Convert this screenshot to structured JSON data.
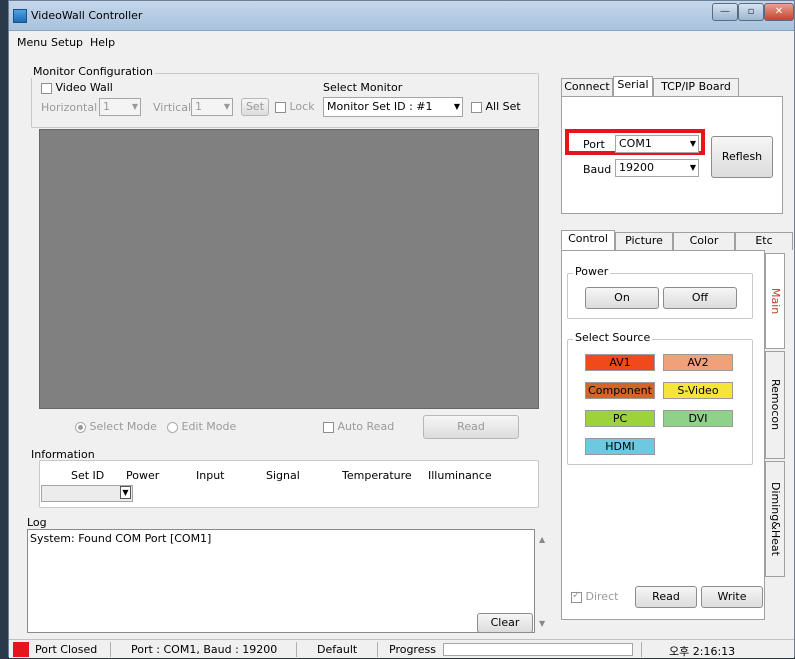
{
  "window": {
    "title": "VideoWall Controller",
    "min_glyph": "—",
    "max_glyph": "▫",
    "close_glyph": "✕"
  },
  "menu": [
    "Menu",
    "Setup",
    "Help"
  ],
  "monitor_config": {
    "label": "Monitor Configuration",
    "video_wall_label": "Video Wall",
    "horizontal_label": "Horizontal",
    "horizontal_value": "1",
    "vertical_label": "Virtical",
    "vertical_value": "1",
    "set_label": "Set",
    "lock_label": "Lock",
    "select_monitor_label": "Select Monitor",
    "monitor_value": "Monitor Set ID : #1",
    "all_set_label": "All Set",
    "select_mode_label": "Select Mode",
    "edit_mode_label": "Edit Mode",
    "auto_read_label": "Auto Read",
    "read_label": "Read"
  },
  "connection": {
    "tabs": [
      "Connect",
      "Serial",
      "TCP/IP Board"
    ],
    "active_tab": "Serial",
    "port_label": "Port",
    "port_value": "COM1",
    "baud_label": "Baud",
    "baud_value": "19200",
    "refresh_label": "Reflesh",
    "highlight_color": "#e8141c"
  },
  "control": {
    "tabs": [
      "Control",
      "Picture",
      "Color",
      "Etc"
    ],
    "power_label": "Power",
    "on_label": "On",
    "off_label": "Off",
    "source_label": "Select Source",
    "sources": [
      {
        "label": "AV1",
        "color": "#f04a1c"
      },
      {
        "label": "AV2",
        "color": "#f2a07a"
      },
      {
        "label": "Component",
        "color": "#d1652a"
      },
      {
        "label": "S-Video",
        "color": "#f5e43a"
      },
      {
        "label": "PC",
        "color": "#9ed23a"
      },
      {
        "label": "DVI",
        "color": "#8fd08a"
      },
      {
        "label": "HDMI",
        "color": "#6cc9e0"
      }
    ],
    "side_tabs": [
      "Main",
      "Remocon",
      "Diming&Heat"
    ],
    "direct_label": "Direct",
    "read_label": "Read",
    "write_label": "Write"
  },
  "information": {
    "label": "Information",
    "columns": [
      "Set ID",
      "Power",
      "Input",
      "Signal",
      "Temperature",
      "Illuminance"
    ]
  },
  "log": {
    "label": "Log",
    "text": "System: Found COM Port [COM1]",
    "clear_label": "Clear"
  },
  "status": {
    "port_state": "Port Closed",
    "port_info": "Port : COM1,  Baud : 19200",
    "mode": "Default",
    "progress_label": "Progress",
    "time": "오후 2:16:13",
    "indicator_color": "#e8141c"
  }
}
